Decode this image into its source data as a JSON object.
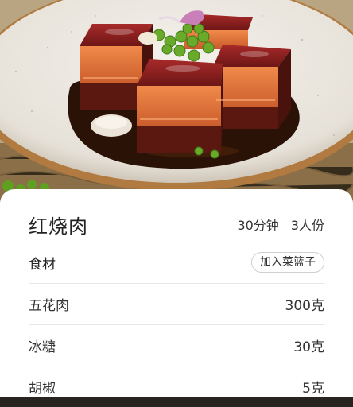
{
  "recipe": {
    "title": "红烧肉",
    "time": "30分钟",
    "servings": "3人份"
  },
  "ingredients": {
    "header": "食材",
    "basket_button": "加入菜篮子",
    "items": [
      {
        "name": "五花肉",
        "amount": "300克"
      },
      {
        "name": "冰糖",
        "amount": "30克"
      },
      {
        "name": "胡椒",
        "amount": "5克"
      }
    ]
  },
  "colors": {
    "card_bg": "#ffffff",
    "pork_glaze": "#8a1e1e",
    "sauce": "#2b1206",
    "peas": "#6aaa2a"
  }
}
